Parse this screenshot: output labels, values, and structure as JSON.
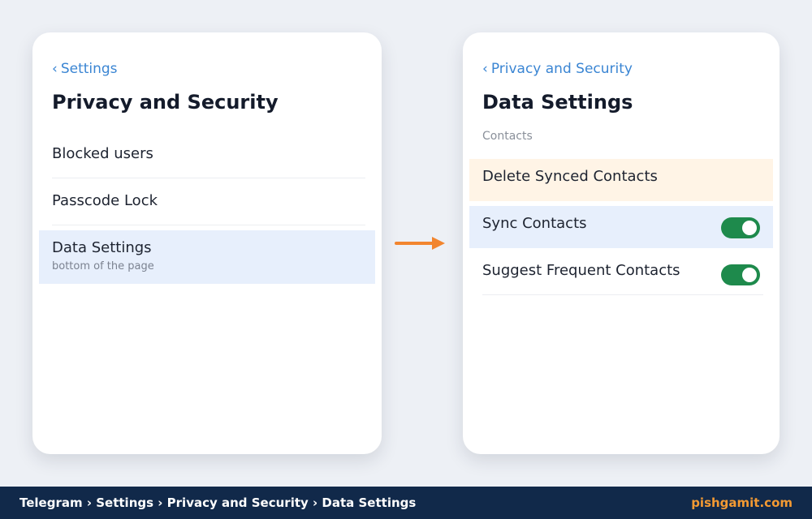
{
  "colors": {
    "background": "#edf0f5",
    "link": "#3a85d3",
    "highlight_blue": "#e7effc",
    "highlight_orange": "#fff4e6",
    "toggle_on": "#1e8a4c",
    "arrow": "#f2852e",
    "footer_bg": "#11294a",
    "brand": "#f39a33"
  },
  "left_screen": {
    "back_chevron": "‹",
    "back_label": "Settings",
    "title": "Privacy and Security",
    "items": [
      {
        "label": "Blocked users"
      },
      {
        "label": "Passcode Lock"
      },
      {
        "label": "Data Settings",
        "sublabel": "bottom of the page",
        "highlighted": true
      }
    ]
  },
  "flow_arrow": {
    "icon": "arrow-right-icon",
    "color": "#f2852e"
  },
  "right_screen": {
    "back_chevron": "‹",
    "back_label": "Privacy and Security",
    "title": "Data Settings",
    "section_label": "Contacts",
    "items": [
      {
        "label": "Delete Synced Contacts",
        "highlight": "orange"
      },
      {
        "label": "Sync Contacts",
        "toggle": true,
        "toggle_on": true,
        "highlight": "blue"
      },
      {
        "label": "Suggest Frequent Contacts",
        "toggle": true,
        "toggle_on": true
      }
    ]
  },
  "footer": {
    "breadcrumb": "Telegram › Settings › Privacy and Security › Data Settings",
    "brand": "pishgamit.com"
  }
}
